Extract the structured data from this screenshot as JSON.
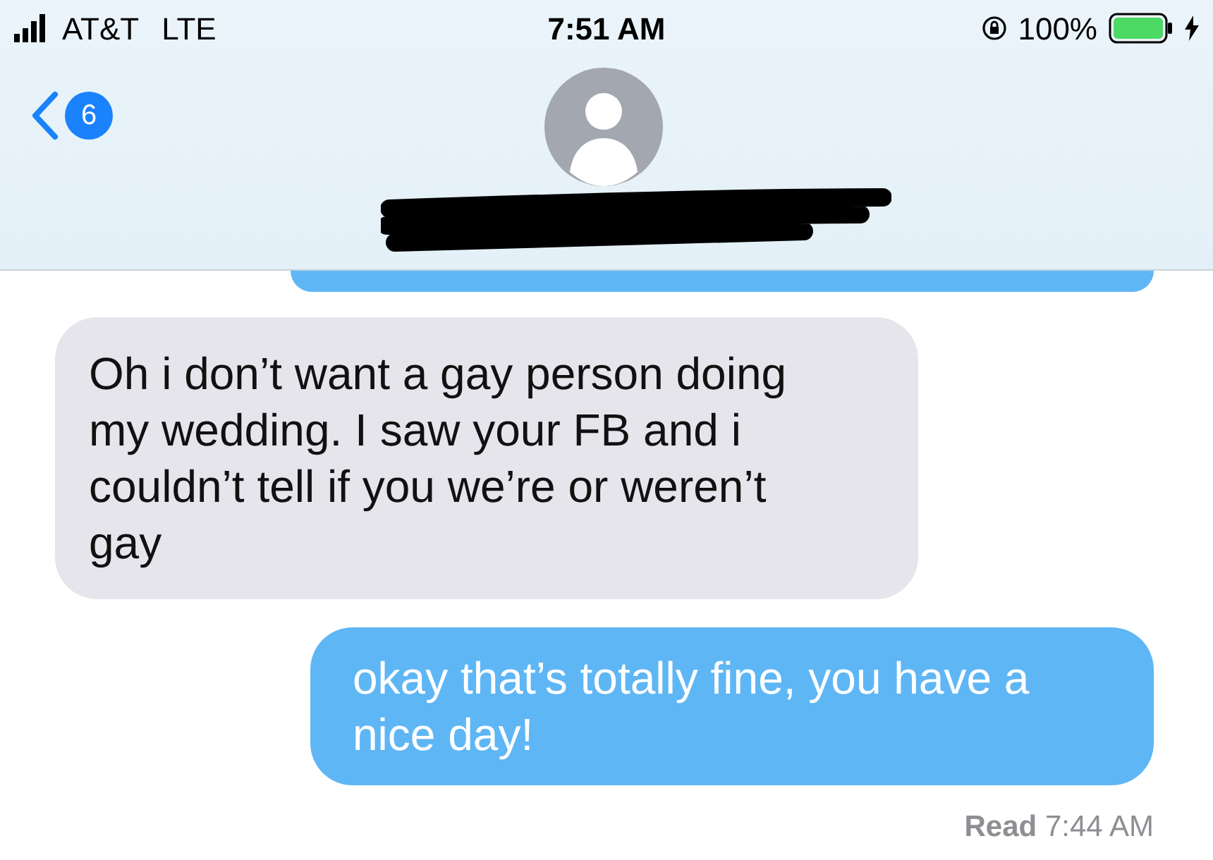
{
  "status_bar": {
    "carrier": "AT&T",
    "network": "LTE",
    "time": "7:51 AM",
    "battery": "100%",
    "charging": true
  },
  "header": {
    "back_count": "6",
    "name_redacted": true
  },
  "messages": [
    {
      "kind": "sent_cut"
    },
    {
      "kind": "received",
      "text": "Oh i don’t want a gay person doing my wedding. I saw your FB and i couldn’t tell if you we’re or weren’t gay"
    },
    {
      "kind": "sent",
      "text": "okay that’s totally fine, you have a nice day!"
    }
  ],
  "receipt": {
    "label": "Read",
    "time": "7:44 AM"
  }
}
